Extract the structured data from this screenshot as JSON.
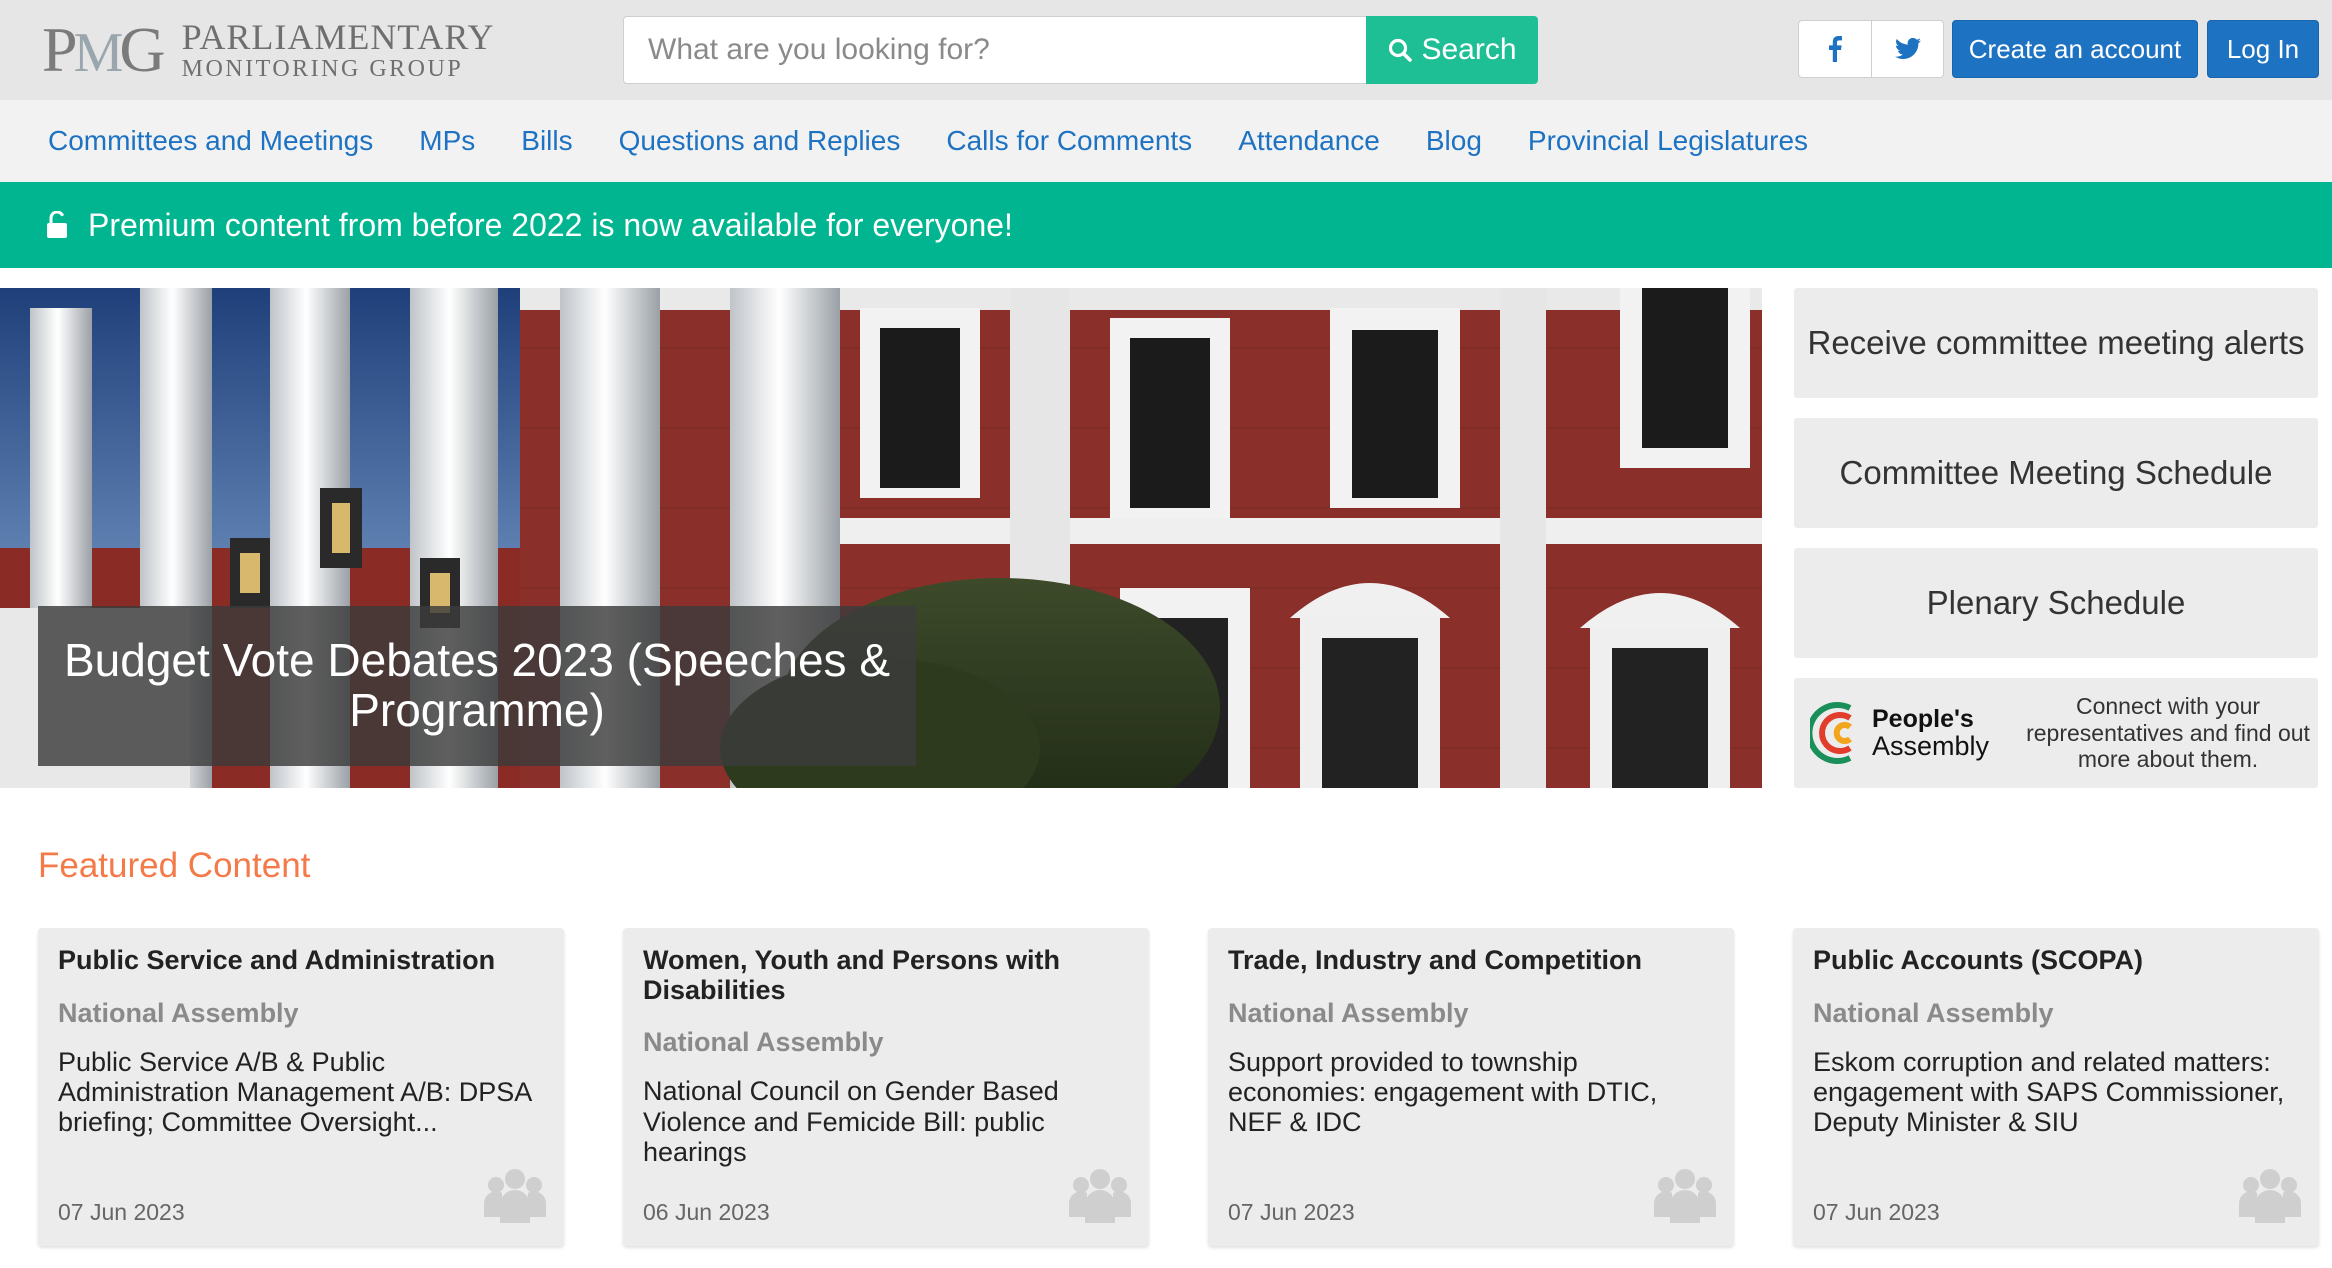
{
  "header": {
    "logo": {
      "mark": "PMG",
      "line1": "PARLIAMENTARY",
      "line2": "MONITORING GROUP"
    },
    "search": {
      "placeholder": "What are you looking for?",
      "button_label": "Search"
    },
    "social": [
      {
        "icon": "facebook-icon",
        "glyph": "f"
      },
      {
        "icon": "twitter-icon",
        "glyph": "t"
      }
    ],
    "create_account_label": "Create an account",
    "login_label": "Log In"
  },
  "nav": {
    "items": [
      "Committees and Meetings",
      "MPs",
      "Bills",
      "Questions and Replies",
      "Calls for Comments",
      "Attendance",
      "Blog",
      "Provincial Legislatures"
    ]
  },
  "banner": {
    "text": "Premium content from before 2022 is now available for everyone!",
    "color": "#00b58f"
  },
  "hero": {
    "caption": "Budget Vote Debates 2023 (Speeches & Programme)"
  },
  "sidebar": {
    "alerts_label": "Receive committee meeting alerts",
    "schedule_label": "Committee Meeting Schedule",
    "plenary_label": "Plenary Schedule",
    "peoples_assembly": {
      "name_line1": "People's",
      "name_line2": "Assembly",
      "description": "Connect with your representatives and find out more about them."
    }
  },
  "featured": {
    "title": "Featured Content",
    "cards": [
      {
        "committee": "Public Service and Administration",
        "house": "National Assembly",
        "description": "Public Service A/B & Public Administration Management A/B: DPSA briefing; Committee Oversight...",
        "date": "07 Jun 2023"
      },
      {
        "committee": "Women, Youth and Persons with Disabilities",
        "house": "National Assembly",
        "description": "National Council on Gender Based Violence and Femicide Bill: public hearings",
        "date": "06 Jun 2023"
      },
      {
        "committee": "Trade, Industry and Competition",
        "house": "National Assembly",
        "description": "Support provided to township economies: engagement with DTIC, NEF & IDC",
        "date": "07 Jun 2023"
      },
      {
        "committee": "Public Accounts (SCOPA)",
        "house": "National Assembly",
        "description": "Eskom corruption and related matters: engagement with SAPS Commissioner, Deputy Minister & SIU",
        "date": "07 Jun 2023"
      }
    ]
  },
  "colors": {
    "accent_green": "#1fbf95",
    "link_blue": "#1d72c2",
    "featured_orange": "#f47b49"
  }
}
